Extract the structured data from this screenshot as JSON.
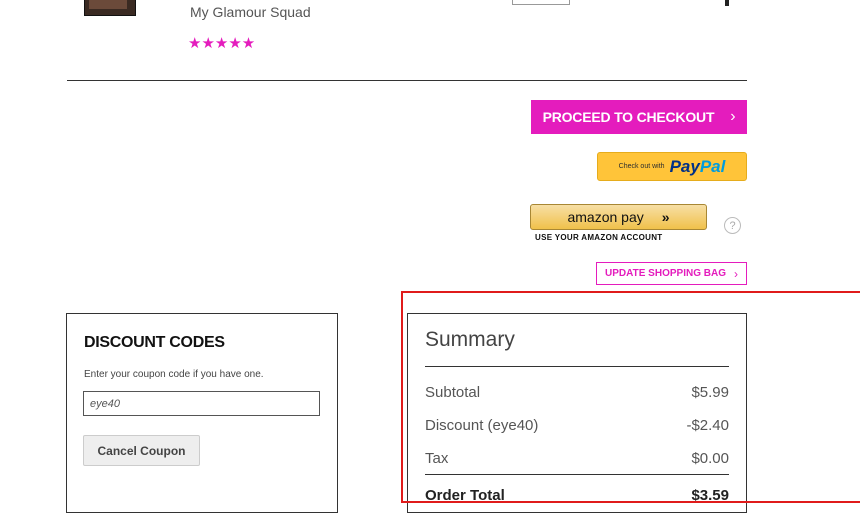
{
  "product": {
    "brand": "My Glamour Squad",
    "stars": "★★★★★"
  },
  "checkout": {
    "proceed_label": "PROCEED TO CHECKOUT",
    "proceed_chevron": "›",
    "paypal_small": "Check out with",
    "paypal_pay": "Pay",
    "paypal_pal": "Pal",
    "amazon_logo_1": "amazon",
    "amazon_logo_2": "pay",
    "amazon_arrow": "»",
    "amazon_sub": "USE YOUR AMAZON ACCOUNT",
    "help_glyph": "?",
    "update_label": "UPDATE SHOPPING BAG",
    "update_chevron": "›"
  },
  "discount": {
    "title": "DISCOUNT CODES",
    "help": "Enter your coupon code if you have one.",
    "coupon_value": "eye40",
    "cancel_label": "Cancel Coupon"
  },
  "summary": {
    "title": "Summary",
    "rows": [
      {
        "label": "Subtotal",
        "value": "$5.99"
      },
      {
        "label": "Discount (eye40)",
        "value": "-$2.40"
      },
      {
        "label": "Tax",
        "value": "$0.00"
      }
    ],
    "total_label": "Order Total",
    "total_value": "$3.59"
  },
  "colors": {
    "accent": "#e41cbd",
    "highlight": "#e01b1b",
    "paypal_bg": "#ffc439",
    "amazon_bg": "#f0c14b"
  }
}
